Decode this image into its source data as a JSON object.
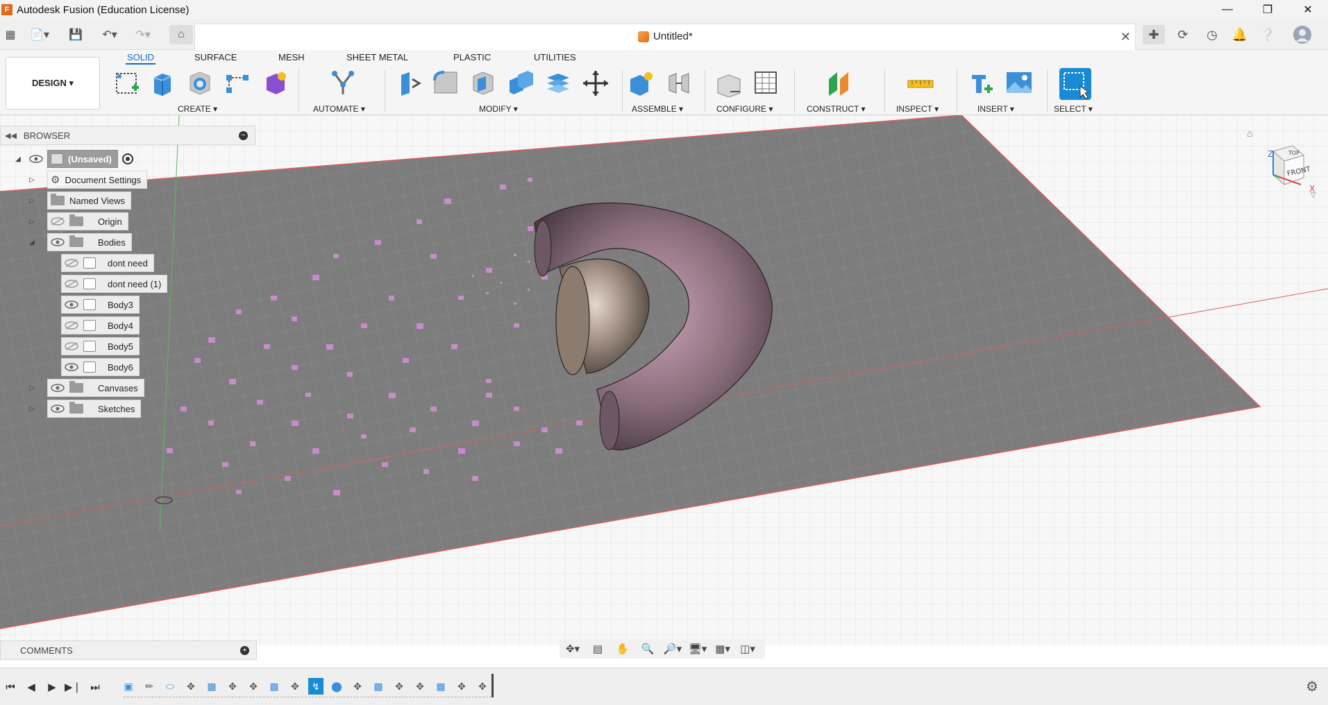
{
  "window": {
    "title": "Autodesk Fusion (Education License)",
    "app_icon": "F",
    "controls": [
      "minimize-icon",
      "restore-icon",
      "close-icon"
    ]
  },
  "quick_access": {
    "icons": [
      "apps-grid-icon",
      "file-menu-icon",
      "save-icon",
      "undo-icon",
      "redo-icon",
      "home-icon"
    ],
    "document_tab": "Untitled*",
    "right_icons": [
      "new-tab-icon",
      "job-status-icon",
      "history-icon",
      "notifications-icon",
      "help-icon",
      "profile-icon"
    ]
  },
  "ribbon": {
    "workspace": "DESIGN ▾",
    "tabs": [
      {
        "label": "SOLID",
        "active": true
      },
      {
        "label": "SURFACE",
        "active": false
      },
      {
        "label": "MESH",
        "active": false
      },
      {
        "label": "SHEET METAL",
        "active": false
      },
      {
        "label": "PLASTIC",
        "active": false
      },
      {
        "label": "UTILITIES",
        "active": false
      }
    ],
    "groups": [
      {
        "label": "CREATE ▾"
      },
      {
        "label": "AUTOMATE ▾"
      },
      {
        "label": "MODIFY ▾"
      },
      {
        "label": "ASSEMBLE ▾"
      },
      {
        "label": "CONFIGURE ▾"
      },
      {
        "label": "CONSTRUCT ▾"
      },
      {
        "label": "INSPECT ▾"
      },
      {
        "label": "INSERT ▾"
      },
      {
        "label": "SELECT ▾"
      }
    ],
    "accent_color": "#0a6ed1"
  },
  "browser": {
    "title": "BROWSER",
    "root": "(Unsaved)",
    "items": [
      {
        "label": "Document Settings",
        "icon": "gear-icon"
      },
      {
        "label": "Named Views",
        "icon": "folder-icon"
      },
      {
        "label": "Origin",
        "icon": "folder-icon",
        "visible": false
      },
      {
        "label": "Bodies",
        "icon": "folder-icon",
        "visible": true
      }
    ],
    "bodies": [
      {
        "label": "dont need",
        "visible": false
      },
      {
        "label": "dont need (1)",
        "visible": false
      },
      {
        "label": "Body3",
        "visible": true
      },
      {
        "label": "Body4",
        "visible": false
      },
      {
        "label": "Body5",
        "visible": false
      },
      {
        "label": "Body6",
        "visible": true
      }
    ],
    "tail": [
      {
        "label": "Canvases",
        "icon": "folder-icon",
        "visible": true
      },
      {
        "label": "Sketches",
        "icon": "folder-icon",
        "visible": true
      }
    ]
  },
  "comments": {
    "title": "COMMENTS"
  },
  "viewcube": {
    "top": "TOP",
    "front": "FRONT",
    "axes": [
      "Z",
      "X"
    ]
  },
  "navbar": {
    "icons": [
      "orbit-icon",
      "look-at-icon",
      "pan-icon",
      "zoom-icon",
      "fit-icon",
      "display-settings-icon",
      "grid-icon",
      "viewports-icon"
    ]
  },
  "timeline": {
    "controls": [
      "first-step-icon",
      "previous-step-icon",
      "play-icon",
      "next-step-icon",
      "last-step-icon"
    ],
    "features": [
      "canvas-icon",
      "sketch-icon",
      "ellipse-icon",
      "move-icon",
      "extrude-icon",
      "move-icon",
      "move-icon",
      "extrude-icon",
      "move-icon",
      "sweep-icon",
      "sphere-icon",
      "move-icon",
      "extrude-icon",
      "move-icon",
      "move-icon",
      "extrude-icon",
      "move-icon",
      "move-icon"
    ],
    "highlighted_index": 9,
    "settings_icon": "gear-icon"
  }
}
